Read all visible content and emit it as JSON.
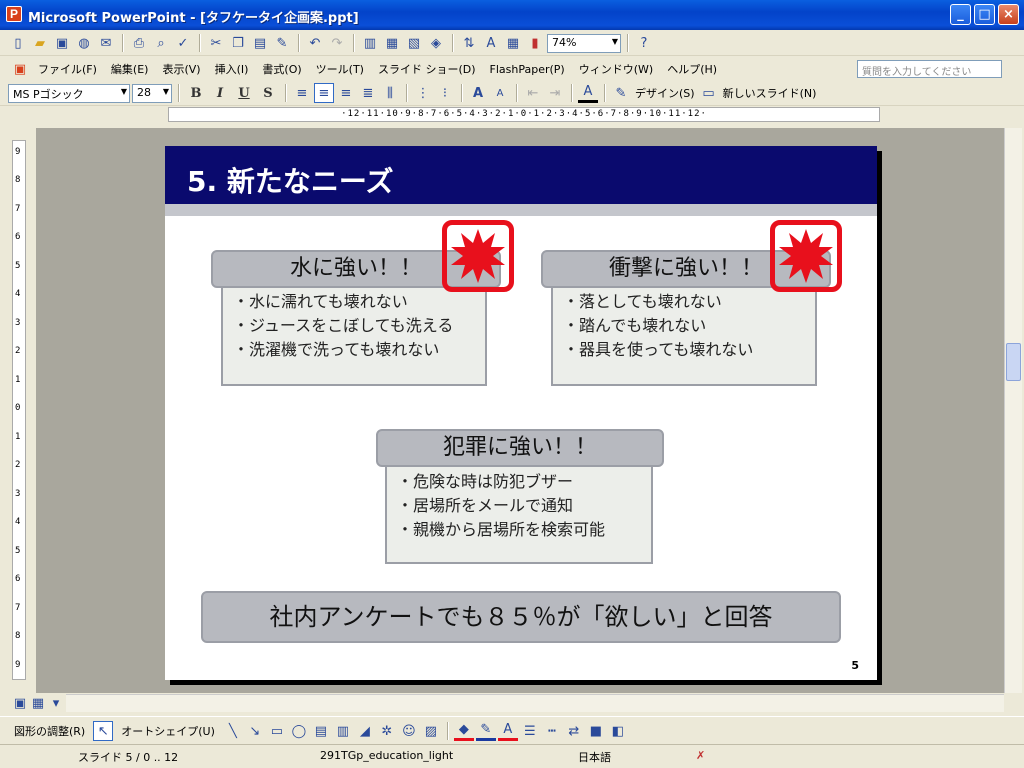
{
  "window": {
    "title": "Microsoft PowerPoint - [タフケータイ企画案.ppt]",
    "buttons": {
      "minimize": "_",
      "maximize": "□",
      "close": "×"
    }
  },
  "toolbar": {
    "zoom": "74%",
    "help_icon": "?"
  },
  "menu": {
    "items": [
      "ファイル(F)",
      "編集(E)",
      "表示(V)",
      "挿入(I)",
      "書式(O)",
      "ツール(T)",
      "スライド ショー(D)",
      "FlashPaper(P)",
      "ウィンドウ(W)",
      "ヘルプ(H)"
    ],
    "help_placeholder": "質問を入力してください"
  },
  "format": {
    "font_name": "MS Pゴシック",
    "font_size": "28",
    "bold": "B",
    "italic": "I",
    "underline": "U",
    "shadow": "S",
    "design_label": "デザイン(S)",
    "new_slide_label": "新しいスライド(N)"
  },
  "ruler": {
    "horizontal": "·12·11·10·9·8·7·6·5·4·3·2·1·0·1·2·3·4·5·6·7·8·9·10·11·12·",
    "vertical": [
      "9",
      "8",
      "7",
      "6",
      "5",
      "4",
      "3",
      "2",
      "1",
      "0",
      "1",
      "2",
      "3",
      "4",
      "5",
      "6",
      "7",
      "8",
      "9"
    ]
  },
  "slide": {
    "title": "5. 新たなニーズ",
    "number": "5",
    "box_water": {
      "heading": "水に強い！！",
      "lines": [
        "・水に濡れても壊れない",
        "・ジュースをこぼしても洗える",
        "・洗濯機で洗っても壊れない"
      ]
    },
    "box_impact": {
      "heading": "衝撃に強い！！",
      "lines": [
        "・落としても壊れない",
        "・踏んでも壊れない",
        "・器具を使っても壊れない"
      ]
    },
    "box_crime": {
      "heading": "犯罪に強い！！",
      "lines": [
        "・危険な時は防犯ブザー",
        "・居場所をメールで通知",
        "・親機から居場所を検索可能"
      ]
    },
    "survey": "社内アンケートでも８５％が「欲しい」と回答"
  },
  "drawing_toolbar": {
    "draw_label": "図形の調整(R)",
    "autoshape_label": "オートシェイプ(U)"
  },
  "status": {
    "slide_info": "スライド 5 / 0 .. 12",
    "template": "291TGp_education_light",
    "language": "日本語"
  }
}
